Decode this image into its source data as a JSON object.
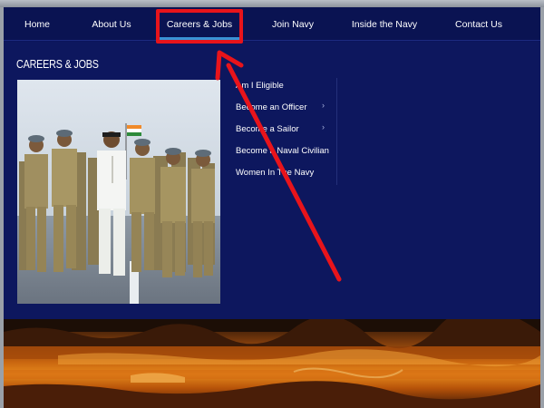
{
  "nav": {
    "items": [
      {
        "label": "Home"
      },
      {
        "label": "About Us"
      },
      {
        "label": "Careers & Jobs"
      },
      {
        "label": "Join Navy"
      },
      {
        "label": "Inside the Navy"
      },
      {
        "label": "Contact Us"
      }
    ],
    "active_index": 2
  },
  "menu": {
    "title": "CAREERS & JOBS",
    "links": [
      {
        "label": "Am I Eligible",
        "has_submenu": false
      },
      {
        "label": "Become an Officer",
        "has_submenu": true
      },
      {
        "label": "Become a Sailor",
        "has_submenu": true
      },
      {
        "label": "Become a Naval Civilian",
        "has_submenu": false
      },
      {
        "label": "Women In The Navy",
        "has_submenu": false
      }
    ],
    "submenu_glyph": "›"
  },
  "colors": {
    "nav_bg": "#0a1352",
    "panel_bg": "#0d175e",
    "active_underline": "#3a93d6",
    "annotation_red": "#e8141b"
  }
}
